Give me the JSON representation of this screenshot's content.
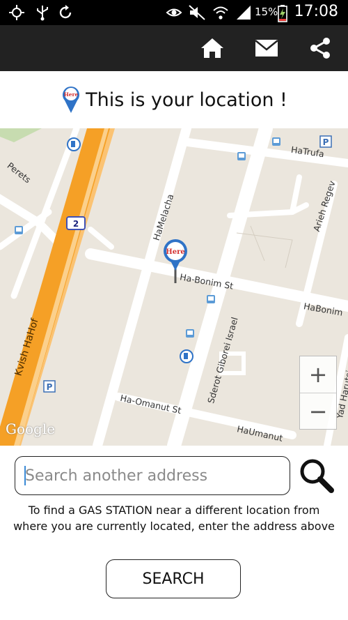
{
  "status_bar": {
    "battery_percent": "15%",
    "time": "17:08",
    "icons": [
      "gps-icon",
      "usb-icon",
      "sync-icon",
      "eye-icon",
      "mute-icon",
      "wifi-icon",
      "signal-icon",
      "battery-charging-icon"
    ]
  },
  "action_bar": {
    "buttons": [
      "home-icon",
      "mail-icon",
      "share-icon"
    ],
    "background": "#222222"
  },
  "heading": {
    "text": "This is your location !",
    "marker_label": "Here"
  },
  "map": {
    "labels": {
      "perets": "Perets",
      "hatrufa": "HaTrufa",
      "arieh_regev": "Arieh Regev",
      "hamelacha": "HaMelacha",
      "ha_bonim_st": "Ha-Bonim St",
      "habonim": "HaBonim",
      "kvish_hahof": "Kvish HaHof",
      "route_number": "2",
      "sderot_giborei_israel": "Sderot Giborei Israel",
      "ha_omanut_st": "Ha-Omanut St",
      "haumanut": "HaUmanut",
      "yad_harutsim_st": "Yad Harutsim St"
    },
    "marker_label": "Here",
    "attribution": "Google",
    "zoom_in": "+",
    "zoom_out": "−",
    "colors": {
      "land": "#ebe6dd",
      "road": "#ffffff",
      "highway": "#f8a02a"
    }
  },
  "search": {
    "placeholder": "Search another address",
    "value": "",
    "icon": "search-icon"
  },
  "help_text": "To find a GAS STATION near a different location from where you are currently located, enter the address above",
  "search_button": "SEARCH"
}
